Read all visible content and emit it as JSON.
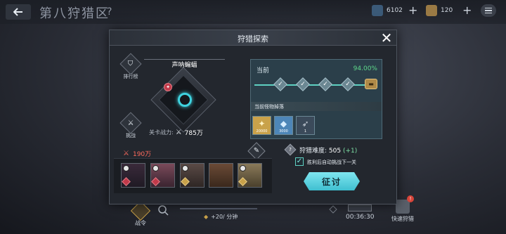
{
  "header": {
    "title": "第八狩猎区",
    "help": "?",
    "resource1_value": "6102",
    "resource2_value": "120",
    "plus": "+"
  },
  "bottom_bar": {
    "warlord_label": "战令",
    "rate_text": "+20/ 分钟",
    "timer": "00:36:30",
    "quick_hunt_label": "快速狩猎",
    "quick_hunt_badge": "!"
  },
  "dialog": {
    "title": "狩猎探索",
    "close": "✕",
    "rank_label": "排行榜",
    "challenge_label": "挑战",
    "boss_name": "声呐蝙蝠",
    "stage_power_label": "关卡战力:",
    "stage_power_value": "785万",
    "current_label": "当前",
    "current_percent": "94.00%",
    "progress_check": "✓",
    "drops_label": "当前怪物掉落",
    "drops": [
      {
        "name": "gold-coin",
        "count": "20000",
        "color": "#c9a24a",
        "glyph": "✦"
      },
      {
        "name": "blue-crystal",
        "count": "3000",
        "color": "#4d86b8",
        "glyph": "◆"
      },
      {
        "name": "ammo",
        "count": "1",
        "color": "#3b4a5a",
        "glyph": "➶"
      }
    ],
    "team_power": "190万",
    "difficulty_label": "狩猎难度:",
    "difficulty_value": "505",
    "difficulty_bonus": "(+1)",
    "auto_next_label": "胜利后自动挑战下一关",
    "fight_button": "征讨",
    "colors": {
      "accent_cyan": "#3fbfd0",
      "progress_green": "#5dd88a",
      "team_power_red": "#ff6b5e"
    },
    "team": [
      {
        "name": "hero-1",
        "color": "#3a2a3a"
      },
      {
        "name": "hero-2",
        "color": "#7a4a5a"
      },
      {
        "name": "hero-3",
        "color": "#5a4a46"
      },
      {
        "name": "hero-4",
        "color": "#6a4a36"
      },
      {
        "name": "hero-5",
        "color": "#8a7a5a"
      }
    ]
  }
}
